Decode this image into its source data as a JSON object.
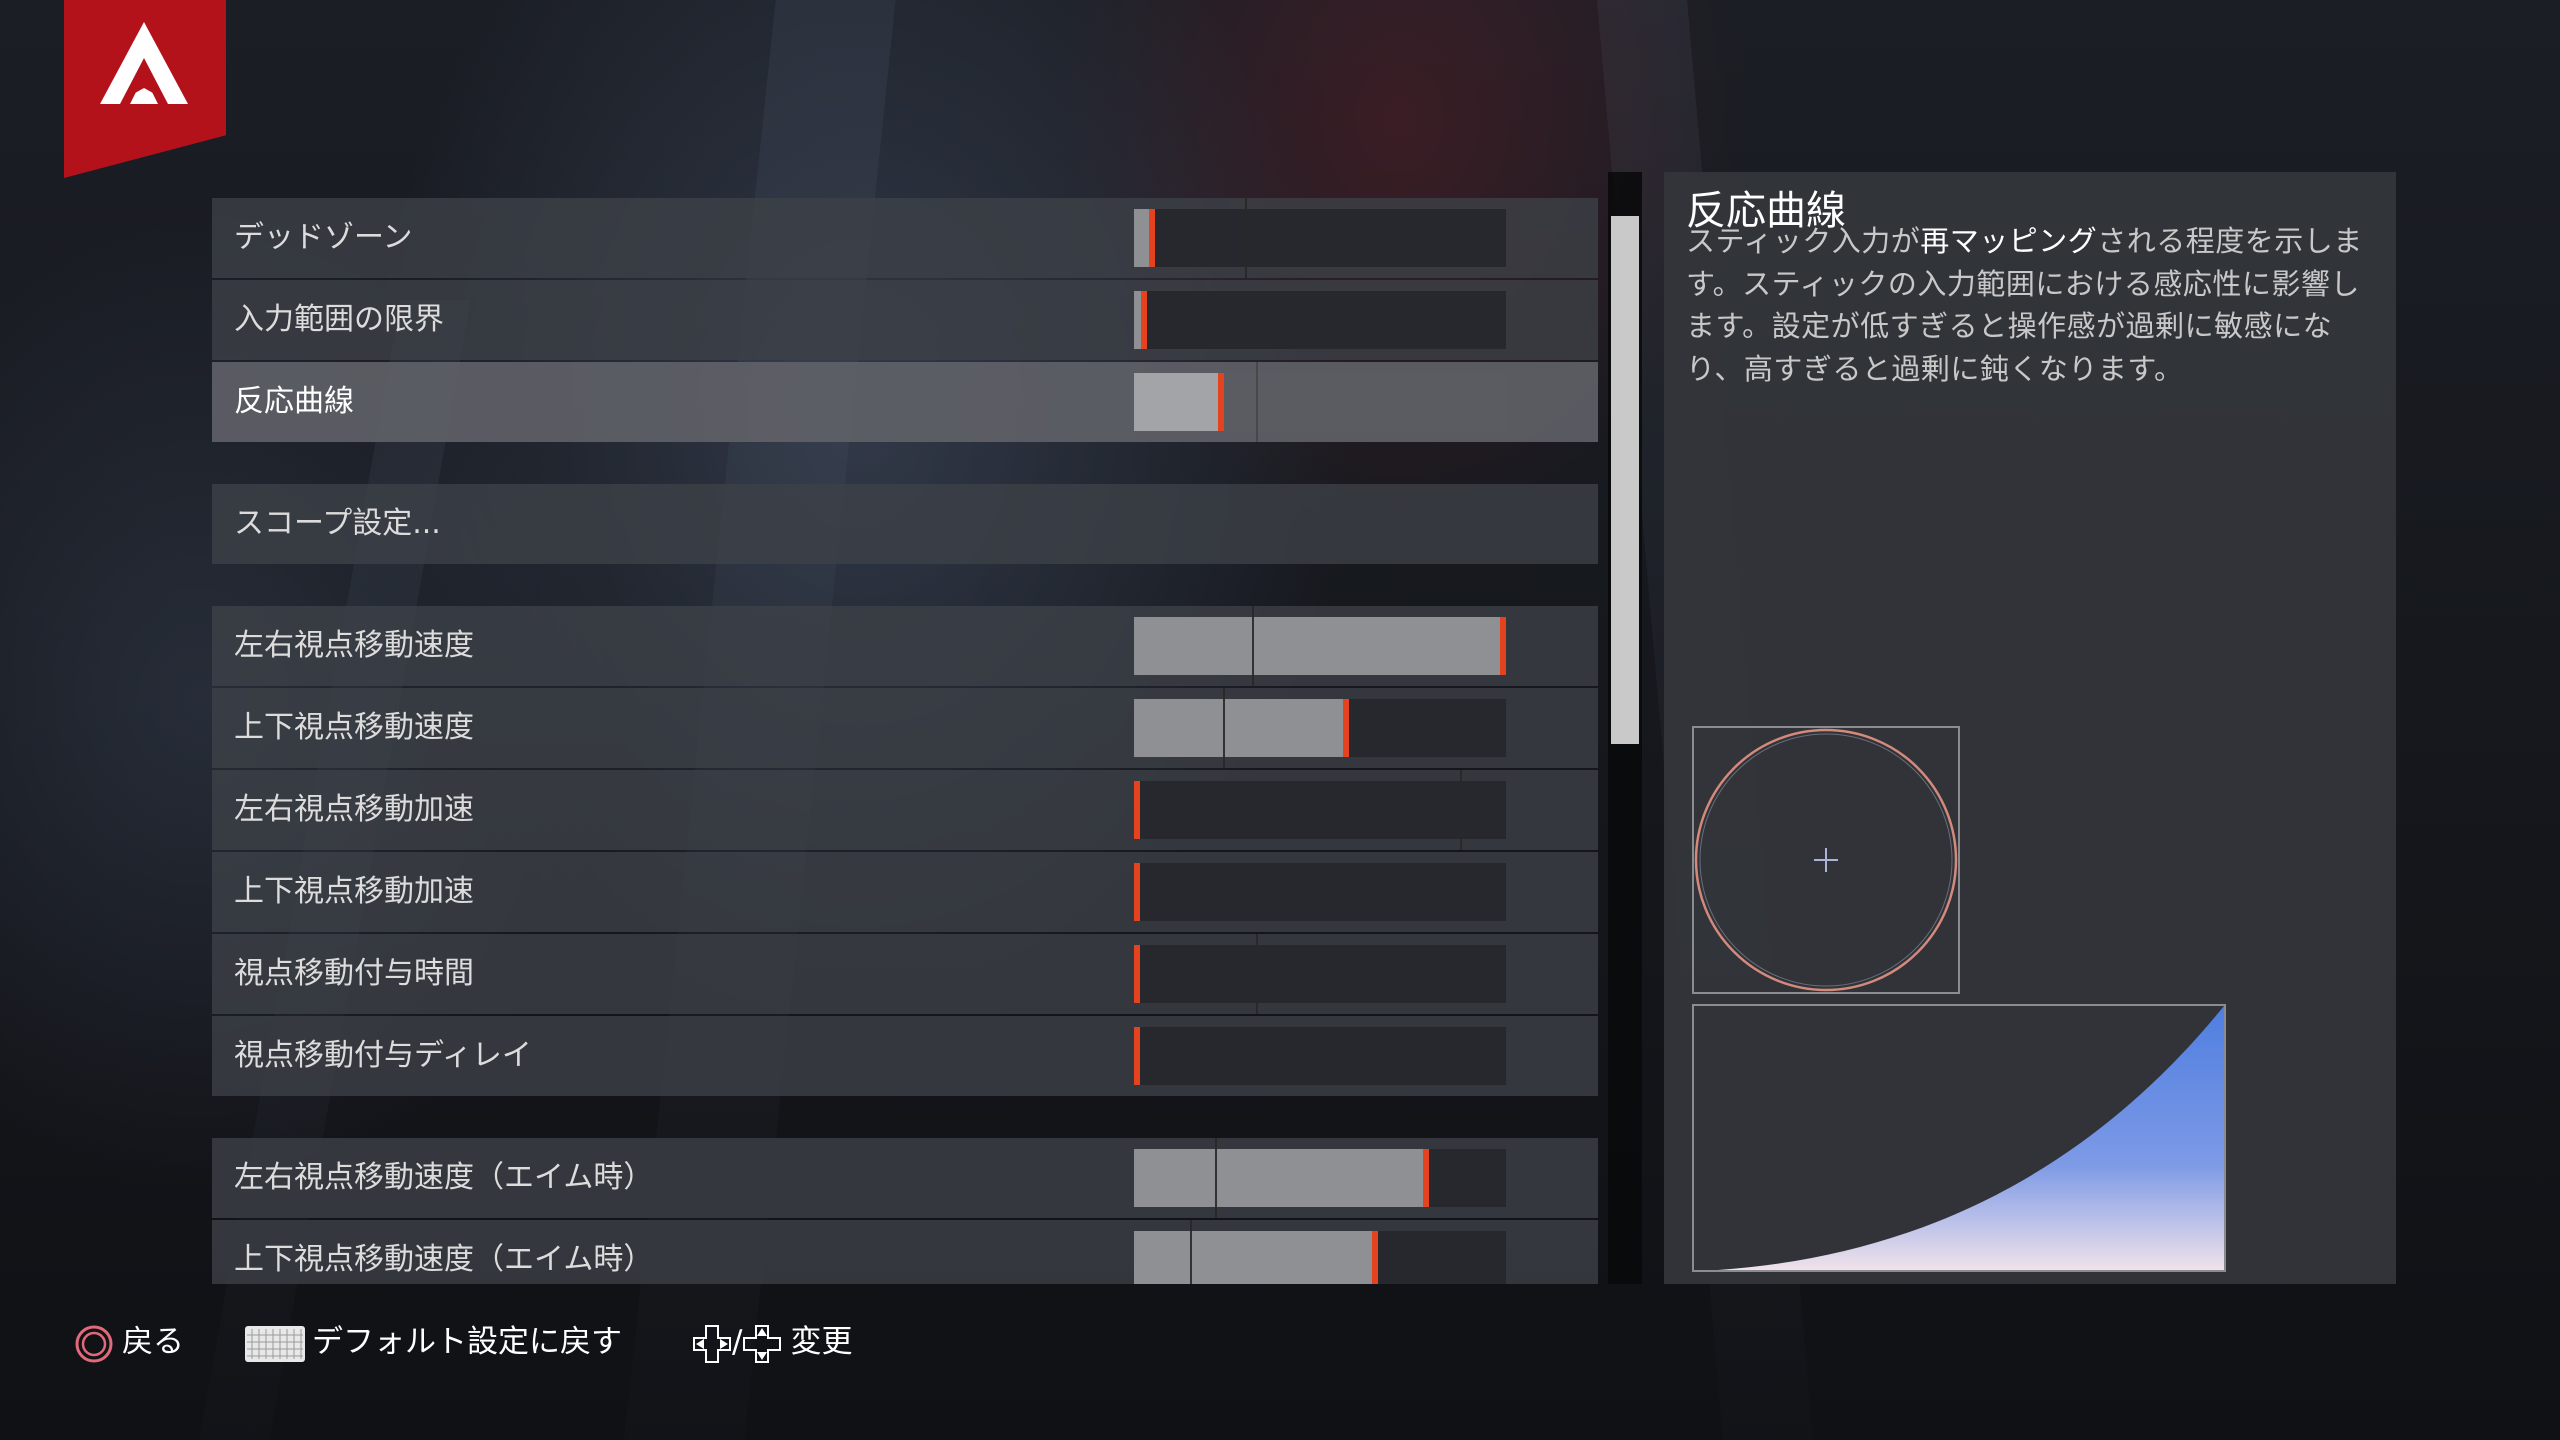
{
  "settings": [
    {
      "label": "デッドゾーン",
      "value": 0.04,
      "default": 0.3,
      "selected": false
    },
    {
      "label": "入力範囲の限界",
      "value": 0.02,
      "default": null,
      "selected": false
    },
    {
      "label": "反応曲線",
      "value": 0.23,
      "default": 0.33,
      "selected": true
    },
    {
      "label": "スコープ設定...",
      "type": "link"
    },
    {
      "label": "左右視点移動速度",
      "value": 1.0,
      "default": 0.32,
      "selected": false
    },
    {
      "label": "上下視点移動速度",
      "value": 0.57,
      "default": 0.24,
      "selected": false
    },
    {
      "label": "左右視点移動加速",
      "value": 0.0,
      "default": 0.88,
      "selected": false
    },
    {
      "label": "上下視点移動加速",
      "value": 0.0,
      "default": null,
      "selected": false
    },
    {
      "label": "視点移動付与時間",
      "value": 0.0,
      "default": 0.33,
      "selected": false
    },
    {
      "label": "視点移動付与ディレイ",
      "value": 0.0,
      "default": null,
      "selected": false
    },
    {
      "label": "左右視点移動速度（エイム時）",
      "value": 0.79,
      "default": 0.22,
      "selected": false
    },
    {
      "label": "上下視点移動速度（エイム時）",
      "value": 0.65,
      "default": 0.15,
      "selected": false
    }
  ],
  "panel": {
    "title": "反応曲線",
    "desc_pre": "スティック入力が",
    "desc_bold": "再マッピング",
    "desc_post": "される程度を示します。スティックの入力範囲における感応性に影響します。設定が低すぎると操作感が過剰に敏感になり、高すぎると過剰に鈍くなります。"
  },
  "footer": {
    "back": "戻る",
    "reset": "デフォルト設定に戻す",
    "change_sep": "/",
    "change": "変更"
  },
  "colors": {
    "accent": "#e5431f",
    "logo_red": "#b3121b",
    "curve_blue": "#4f7ee0",
    "circle": "#d38a7c"
  }
}
